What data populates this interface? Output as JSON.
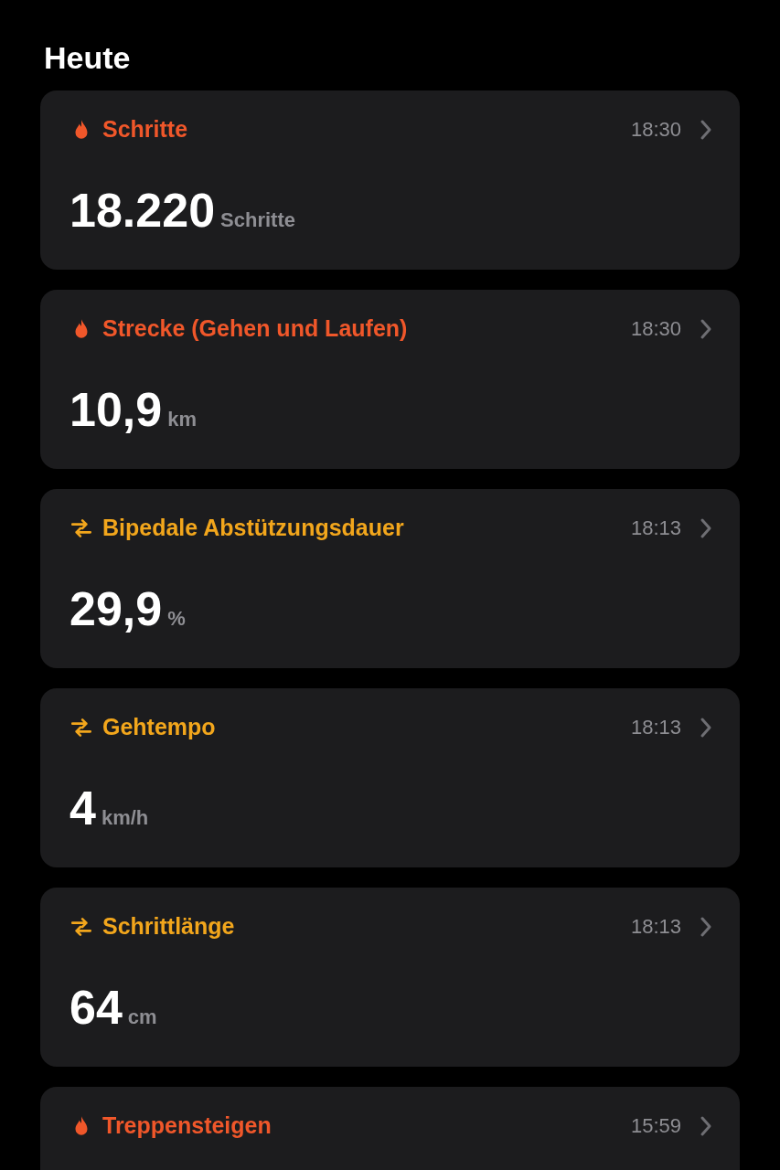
{
  "header": {
    "title": "Heute"
  },
  "cards": [
    {
      "kind": "activity",
      "title": "Schritte",
      "time": "18:30",
      "value": "18.220",
      "unit": "Schritte"
    },
    {
      "kind": "activity",
      "title": "Strecke (Gehen und Laufen)",
      "time": "18:30",
      "value": "10,9",
      "unit": "km"
    },
    {
      "kind": "mobility",
      "title": "Bipedale Abstützungsdauer",
      "time": "18:13",
      "value": "29,9",
      "unit": "%"
    },
    {
      "kind": "mobility",
      "title": "Gehtempo",
      "time": "18:13",
      "value": "4",
      "unit": "km/h"
    },
    {
      "kind": "mobility",
      "title": "Schrittlänge",
      "time": "18:13",
      "value": "64",
      "unit": "cm"
    },
    {
      "kind": "activity",
      "title": "Treppensteigen",
      "time": "15:59"
    }
  ]
}
